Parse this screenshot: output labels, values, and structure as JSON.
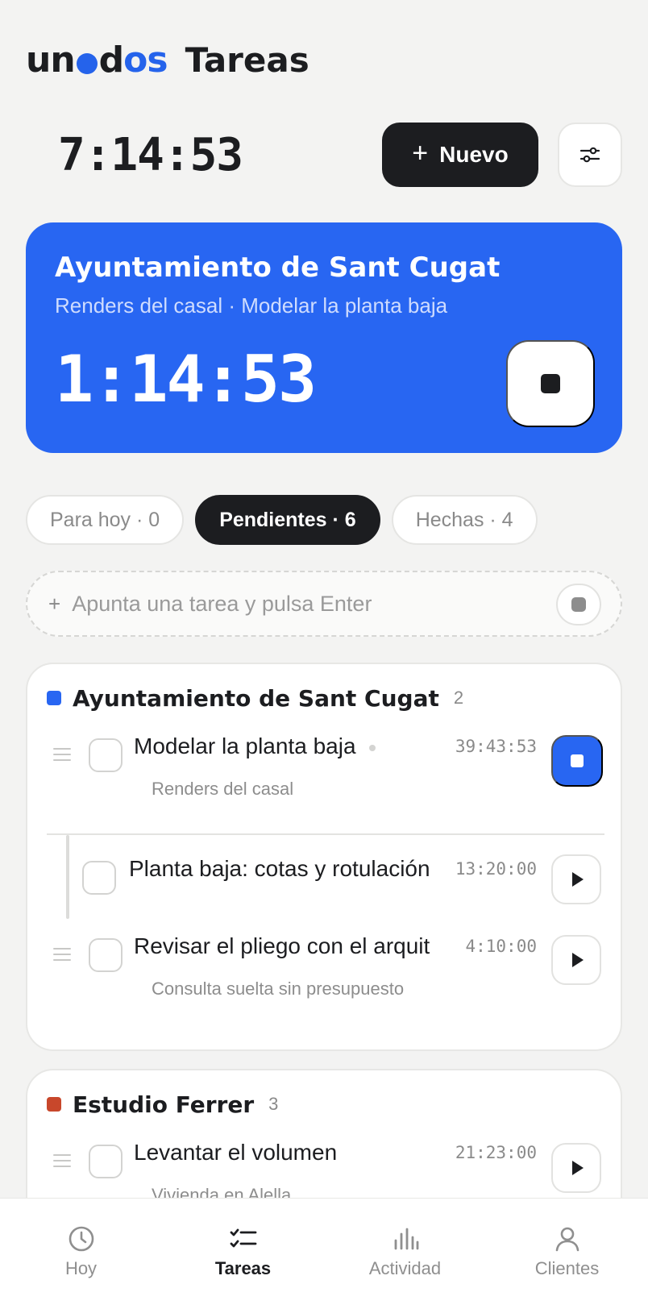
{
  "header": {
    "logo": {
      "part1": "un",
      "part2": "d",
      "part3": "os"
    },
    "title": "Tareas",
    "clock": "7:14:53",
    "new_button": {
      "icon": "plus-icon",
      "label": "Nuevo"
    },
    "filter_button_icon": "sliders-icon"
  },
  "active_timer": {
    "client": "Ayuntamiento de Sant Cugat",
    "subtitle": "Renders del casal · Modelar la planta baja",
    "elapsed": "1:14:53",
    "stop_icon": "stop-icon"
  },
  "tabs": [
    {
      "label": "Para hoy · 0",
      "active": false
    },
    {
      "label": "Pendientes · 6",
      "active": true
    },
    {
      "label": "Hechas · 4",
      "active": false
    }
  ],
  "quick_add": {
    "placeholder": "Apunta una tarea y pulsa Enter",
    "icon": "plus-icon",
    "mic_icon": "record-icon"
  },
  "groups": [
    {
      "name": "Ayuntamiento de Sant Cugat",
      "color": "#2866f2",
      "count": "2",
      "tasks": [
        {
          "title": "Modelar la planta baja",
          "subtitle": "Renders del casal",
          "time": "39:43:53",
          "running": true
        },
        {
          "title": "Planta baja: cotas y rotulación",
          "subtitle": "",
          "time": "13:20:00",
          "running": false,
          "subtask": true
        },
        {
          "title": "Revisar el pliego con el arquit",
          "subtitle": "Consulta suelta sin presupuesto",
          "time": "4:10:00",
          "running": false
        }
      ]
    },
    {
      "name": "Estudio Ferrer",
      "color": "#c8472b",
      "count": "3",
      "tasks": [
        {
          "title": "Levantar el volumen",
          "subtitle": "Vivienda en Alella",
          "time": "21:23:00",
          "running": false
        }
      ]
    }
  ],
  "bottom_nav": [
    {
      "label": "Hoy",
      "icon": "clock-icon",
      "active": false
    },
    {
      "label": "Tareas",
      "icon": "checklist-icon",
      "active": true
    },
    {
      "label": "Actividad",
      "icon": "bar-chart-icon",
      "active": false
    },
    {
      "label": "Clientes",
      "icon": "person-icon",
      "active": false
    }
  ]
}
